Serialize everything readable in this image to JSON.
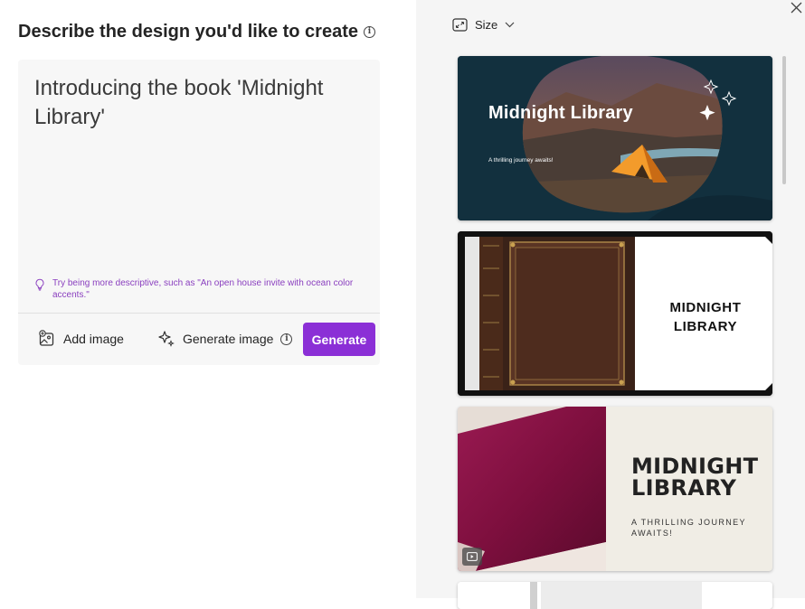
{
  "left": {
    "heading": "Describe the design you'd like to create",
    "prompt_value": "Introducing the book 'Midnight Library'",
    "hint": "Try being more descriptive, such as \"An open house invite with ocean color accents.\"",
    "add_image_label": "Add image",
    "generate_image_label": "Generate image",
    "generate_button_label": "Generate"
  },
  "right": {
    "size_label": "Size",
    "designs": [
      {
        "title": "Midnight Library",
        "subtitle": "A thrilling journey awaits!"
      },
      {
        "title_line1": "MIDNIGHT",
        "title_line2": "LIBRARY"
      },
      {
        "title_line1": "MIDNIGHT",
        "title_line2": "LIBRARY",
        "subtitle_line1": "A THRILLING JOURNEY",
        "subtitle_line2": "AWAITS!"
      }
    ]
  },
  "colors": {
    "accent": "#8b2fd6",
    "hint": "#8a3fbf",
    "panel_bg": "#f5f5f5",
    "prompt_bg": "#f7f7f7"
  },
  "icons": [
    "info-icon",
    "lightbulb-icon",
    "add-image-icon",
    "sparkle-icon",
    "resize-icon",
    "chevron-down-icon",
    "close-icon",
    "video-icon"
  ]
}
